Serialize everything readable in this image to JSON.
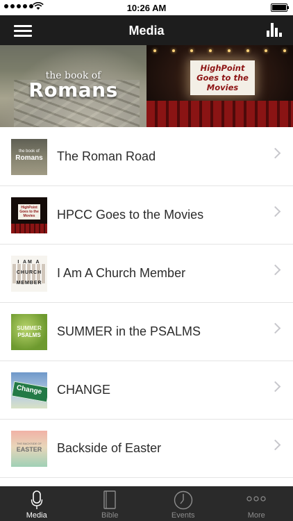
{
  "status_bar": {
    "time": "10:26 AM"
  },
  "nav": {
    "title": "Media"
  },
  "banner": {
    "left": {
      "small": "the book of",
      "big": "Romans"
    },
    "right": {
      "line1": "HighPoint",
      "line2": "Goes to the",
      "line3": "Movies"
    }
  },
  "list": {
    "items": [
      {
        "label": "The Roman Road",
        "thumb_icon": "romans-thumbnail"
      },
      {
        "label": "HPCC Goes to the Movies",
        "thumb_icon": "movies-thumbnail"
      },
      {
        "label": "I Am A Church Member",
        "thumb_icon": "church-member-thumbnail"
      },
      {
        "label": "SUMMER in the PSALMS",
        "thumb_icon": "summer-psalms-thumbnail"
      },
      {
        "label": "CHANGE",
        "thumb_icon": "change-thumbnail"
      },
      {
        "label": "Backside of Easter",
        "thumb_icon": "easter-thumbnail"
      }
    ],
    "thumb_text": {
      "romans_small": "the book of",
      "romans_big": "Romans",
      "movies": "HighPoint Goes to the Movies",
      "member_1": "I AM A",
      "member_2": "CHURCH",
      "member_3": "MEMBER",
      "summer_1": "SUMMER",
      "summer_2": "PSALMS",
      "change": "Change",
      "easter_1": "THE BACKSIDE OF",
      "easter_2": "EASTER"
    }
  },
  "tabbar": {
    "tabs": [
      {
        "label": "Media",
        "icon": "microphone-icon",
        "active": true
      },
      {
        "label": "Bible",
        "icon": "book-icon",
        "active": false
      },
      {
        "label": "Events",
        "icon": "clock-icon",
        "active": false
      },
      {
        "label": "More",
        "icon": "ellipsis-icon",
        "active": false
      }
    ]
  },
  "colors": {
    "nav_bg": "#1d1d1d",
    "tabbar_bg": "#2a2a2a",
    "chevron": "#c7c7cc",
    "active_tab": "#ffffff",
    "inactive_tab": "#8e8e8e"
  }
}
